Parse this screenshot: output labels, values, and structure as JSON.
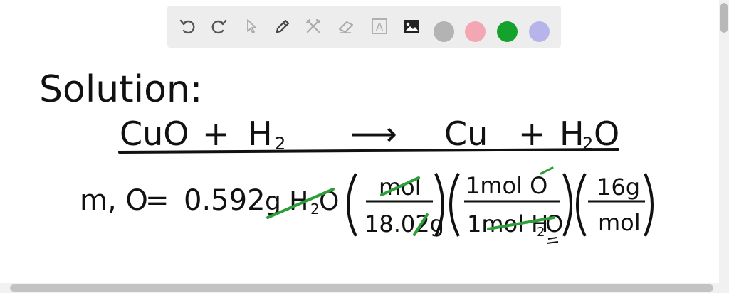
{
  "toolbar": {
    "tools": [
      {
        "name": "undo-icon"
      },
      {
        "name": "redo-icon"
      },
      {
        "name": "select-cursor-icon"
      },
      {
        "name": "pen-icon"
      },
      {
        "name": "tools-icon"
      },
      {
        "name": "eraser-icon"
      },
      {
        "name": "text-box-icon",
        "glyph": "A"
      },
      {
        "name": "image-icon"
      }
    ],
    "colors": [
      "#b3b3b3",
      "#f2a7b2",
      "#15a22c",
      "#b7b4ec"
    ]
  },
  "whiteboard": {
    "heading": "Solution:",
    "equation": {
      "reactant_1": "CuO",
      "plus_1": "+",
      "reactant_2": "H",
      "reactant_2_sub": "2",
      "arrow": "⟶",
      "product_1": "Cu",
      "plus_2": "+",
      "product_2": "H",
      "product_2_sub": "2",
      "product_2_tail": "O"
    },
    "calc": {
      "lhs": "m, O",
      "equals": "=",
      "mass": "0.592",
      "mass_unit": "g H",
      "mass_unit_sub": "2",
      "mass_unit_tail": "O",
      "f1_num": "mol",
      "f1_den": "18.02g",
      "f2_num": "1mol O",
      "f2_den": "1mol H",
      "f2_den_sub": "2",
      "f2_den_tail": "O",
      "f3_num": "16g",
      "f3_den": "mol"
    },
    "ink_colors": {
      "main": "#111111",
      "cancel": "#2e9e3a"
    }
  }
}
